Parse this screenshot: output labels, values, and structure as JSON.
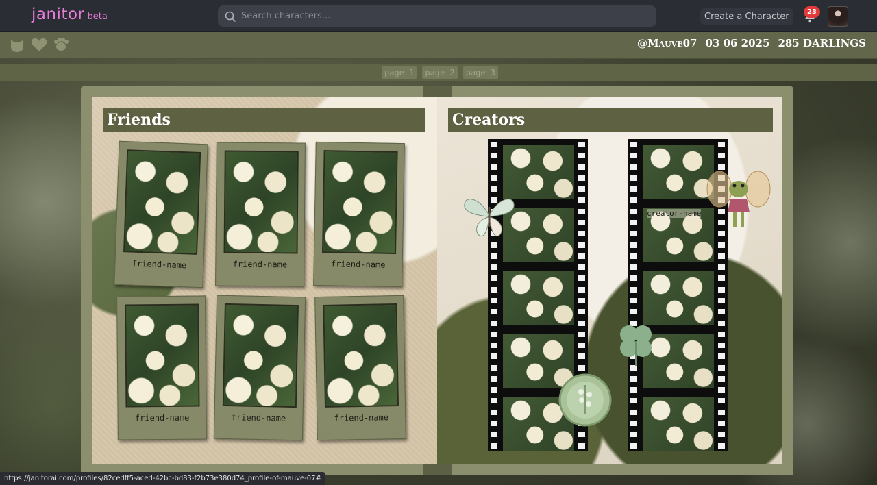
{
  "nav": {
    "logo": "janitor",
    "logo_badge": "beta",
    "search_placeholder": "Search characters...",
    "create_button": "Create a Character",
    "notification_count": "23",
    "accent_color": "#e77ddb"
  },
  "profile": {
    "icons": [
      "cat-icon",
      "heart-icon",
      "paw-icon"
    ],
    "handle": "@Mauve07",
    "joined_date": "03 06 2025",
    "followers": "285 DARLINGS"
  },
  "pagination": [
    "page 1",
    "page 2",
    "page 3"
  ],
  "friends": {
    "title": "Friends",
    "cards": [
      {
        "name": "friend-name"
      },
      {
        "name": "friend-name"
      },
      {
        "name": "friend-name"
      },
      {
        "name": "friend-name"
      },
      {
        "name": "friend-name"
      },
      {
        "name": "friend-name"
      }
    ]
  },
  "creators": {
    "title": "Creators",
    "label": "creator-name"
  },
  "status_bar": {
    "url": "https://janitorai.com/profiles/82cedff5-aced-42bc-bd83-f2b73e380d74_profile-of-mauve-07#"
  },
  "colors": {
    "olive_dark": "#5e6243",
    "olive_mid": "#8b8f6d",
    "nav_bg": "#2a2d34",
    "badge_red": "#e23a3a"
  }
}
